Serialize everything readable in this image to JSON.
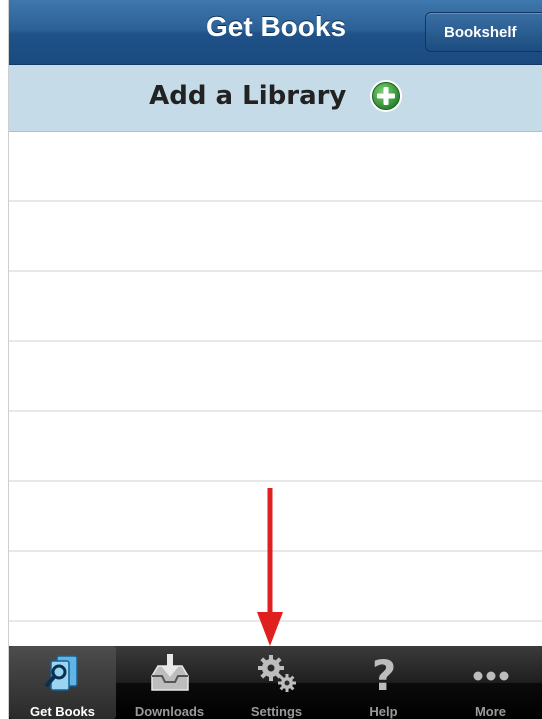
{
  "navbar": {
    "title": "Get Books",
    "bookshelf_label": "Bookshelf"
  },
  "add_library": {
    "label": "Add a Library",
    "icon": "plus-circle-icon"
  },
  "list": {
    "rows": [
      "",
      "",
      "",
      "",
      "",
      "",
      ""
    ]
  },
  "tabbar": {
    "tabs": [
      {
        "label": "Get Books",
        "icon": "get-books-icon",
        "selected": true
      },
      {
        "label": "Downloads",
        "icon": "downloads-icon",
        "selected": false
      },
      {
        "label": "Settings",
        "icon": "settings-gears-icon",
        "selected": false
      },
      {
        "label": "Help",
        "icon": "question-mark-icon",
        "selected": false
      },
      {
        "label": "More",
        "icon": "more-dots-icon",
        "selected": false
      }
    ]
  },
  "colors": {
    "navbar": "#2a5f95",
    "add_bar": "#c6dbe8",
    "accent_green": "#2f9a3a",
    "arrow": "#e01f1f"
  }
}
